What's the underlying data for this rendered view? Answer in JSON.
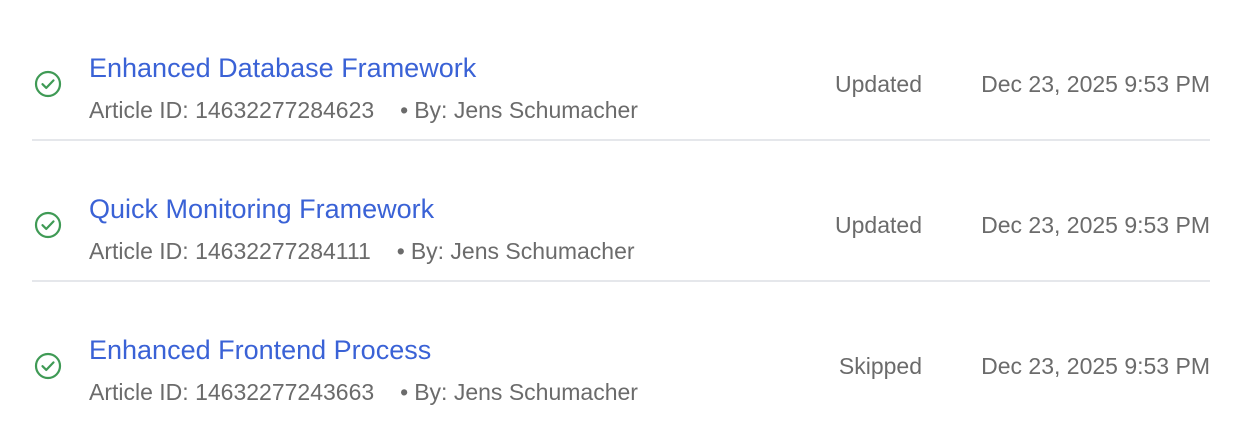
{
  "articles": [
    {
      "title": "Enhanced Database Framework",
      "article_id_label": "Article ID: 14632277284623",
      "separator": "•",
      "author_label": "By: Jens Schumacher",
      "status": "Updated",
      "date": "Dec 23, 2025 9:53 PM"
    },
    {
      "title": "Quick Monitoring Framework",
      "article_id_label": "Article ID: 14632277284111",
      "separator": "•",
      "author_label": "By: Jens Schumacher",
      "status": "Updated",
      "date": "Dec 23, 2025 9:53 PM"
    },
    {
      "title": "Enhanced Frontend Process",
      "article_id_label": "Article ID: 14632277243663",
      "separator": "•",
      "author_label": "By: Jens Schumacher",
      "status": "Skipped",
      "date": "Dec 23, 2025 9:53 PM"
    }
  ],
  "icons": {
    "status_icon": "check-circle-icon"
  },
  "colors": {
    "link": "#3a62d6",
    "success": "#3f9a55",
    "muted_text": "#6b6b6b",
    "divider": "#e5e7eb"
  }
}
